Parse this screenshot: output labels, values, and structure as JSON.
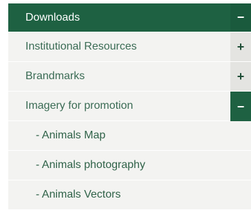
{
  "menu": {
    "items": [
      {
        "label": "Downloads",
        "toggle": "−"
      },
      {
        "label": "Institutional Resources",
        "toggle": "+"
      },
      {
        "label": "Brandmarks",
        "toggle": "+"
      },
      {
        "label": "Imagery for promotion",
        "toggle": "−"
      }
    ],
    "subitems": [
      {
        "label": "- Animals Map"
      },
      {
        "label": "- Animals photography"
      },
      {
        "label": "- Animals Vectors"
      }
    ]
  },
  "colors": {
    "header_bg": "#1e6142",
    "row_bg": "#f3f3f1",
    "toggle_plus_bg": "#e4e4e1",
    "text": "#3a6b54"
  }
}
